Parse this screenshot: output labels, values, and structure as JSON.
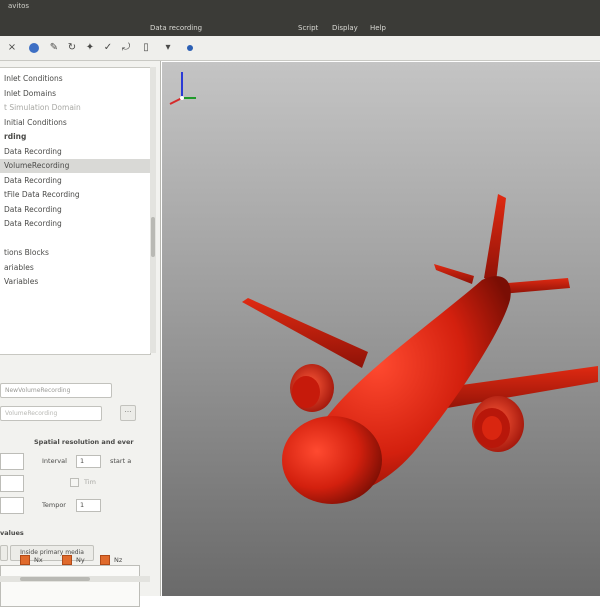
{
  "window": {
    "title": "avitos"
  },
  "menu": {
    "items": [
      {
        "label": "Data recording",
        "dim": false
      },
      {
        "label": "Script",
        "dim": false
      },
      {
        "label": "Display",
        "dim": false
      },
      {
        "label": "Help",
        "dim": false
      }
    ]
  },
  "tree": {
    "items": [
      {
        "label": "Inlet Conditions",
        "style": ""
      },
      {
        "label": "Inlet Domains",
        "style": ""
      },
      {
        "label": "t Simulation Domain",
        "style": "faded"
      },
      {
        "label": "Initial Conditions",
        "style": ""
      },
      {
        "label": "rding",
        "style": "bold"
      },
      {
        "label": "Data Recording",
        "style": ""
      },
      {
        "label": "VolumeRecording",
        "style": "selected"
      },
      {
        "label": "Data Recording",
        "style": ""
      },
      {
        "label": "tFile Data Recording",
        "style": ""
      },
      {
        "label": "Data Recording",
        "style": ""
      },
      {
        "label": "Data Recording",
        "style": ""
      },
      {
        "label": "",
        "style": ""
      },
      {
        "label": "tions Blocks",
        "style": ""
      },
      {
        "label": "ariables",
        "style": ""
      },
      {
        "label": "Variables",
        "style": ""
      }
    ]
  },
  "props": {
    "name_value": "NewVolumeRecording",
    "second_value": "VolumeRecording",
    "section_heading": "Spatial resolution and ever",
    "interval_label": "Interval",
    "interval_value": "1",
    "start_label": "start a",
    "time_label": "Tim",
    "temporal_label": "Tempor",
    "temporal_value": "1",
    "values_heading": "values",
    "compute_button": "Inside primary media",
    "checks": [
      "Nx",
      "Ny",
      "Nz"
    ]
  },
  "colors": {
    "aircraft": "#d3200e",
    "menubar": "#3b3b37"
  }
}
